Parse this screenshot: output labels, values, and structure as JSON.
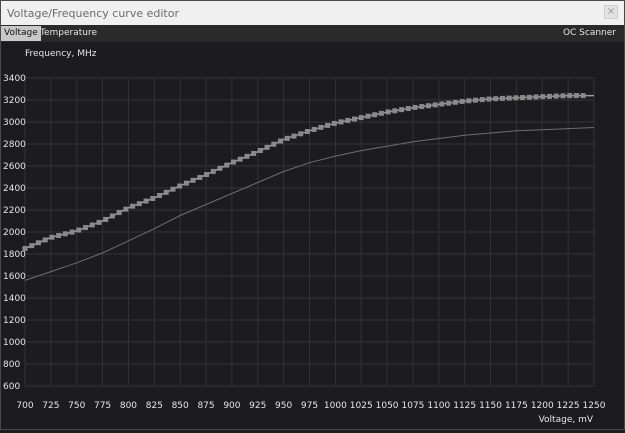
{
  "window": {
    "title": "Voltage/Frequency curve editor",
    "close_glyph": "×"
  },
  "tabs": [
    {
      "label": "Voltage",
      "active": true
    },
    {
      "label": "Temperature",
      "active": false
    }
  ],
  "toolbar": {
    "oc_scanner_label": "OC Scanner"
  },
  "colors": {
    "background": "#1c1c1e",
    "grid": "#333336",
    "curve": "#9a9a9a",
    "base_curve": "#6e6e6e",
    "text": "#e6e6e6"
  },
  "chart_data": {
    "type": "line",
    "ylabel": "Frequency, MHz",
    "xlabel": "Voltage, mV",
    "xlim": [
      700,
      1250
    ],
    "ylim": [
      600,
      3400
    ],
    "xticks": [
      700,
      725,
      750,
      775,
      800,
      825,
      850,
      875,
      900,
      925,
      950,
      975,
      1000,
      1025,
      1050,
      1075,
      1100,
      1125,
      1150,
      1175,
      1200,
      1225,
      1250
    ],
    "yticks": [
      600,
      800,
      1000,
      1200,
      1400,
      1600,
      1800,
      2000,
      2200,
      2400,
      2600,
      2800,
      3000,
      3200,
      3400
    ],
    "grid": true,
    "series": [
      {
        "role": "curve-with-points",
        "x": [
          700,
          725,
          750,
          775,
          800,
          825,
          850,
          875,
          900,
          925,
          950,
          975,
          1000,
          1025,
          1050,
          1075,
          1100,
          1125,
          1150,
          1175,
          1200,
          1225,
          1250
        ],
        "y": [
          1850,
          1950,
          2010,
          2100,
          2220,
          2310,
          2420,
          2520,
          2630,
          2730,
          2840,
          2920,
          2990,
          3040,
          3090,
          3130,
          3160,
          3190,
          3210,
          3220,
          3230,
          3240,
          3240
        ]
      },
      {
        "role": "base-curve",
        "x": [
          700,
          725,
          750,
          775,
          800,
          825,
          850,
          875,
          900,
          925,
          950,
          975,
          1000,
          1025,
          1050,
          1075,
          1100,
          1125,
          1150,
          1175,
          1200,
          1225,
          1250
        ],
        "y": [
          1560,
          1640,
          1720,
          1810,
          1920,
          2030,
          2150,
          2250,
          2350,
          2450,
          2550,
          2630,
          2690,
          2740,
          2780,
          2820,
          2850,
          2880,
          2900,
          2920,
          2930,
          2940,
          2950
        ]
      }
    ]
  }
}
